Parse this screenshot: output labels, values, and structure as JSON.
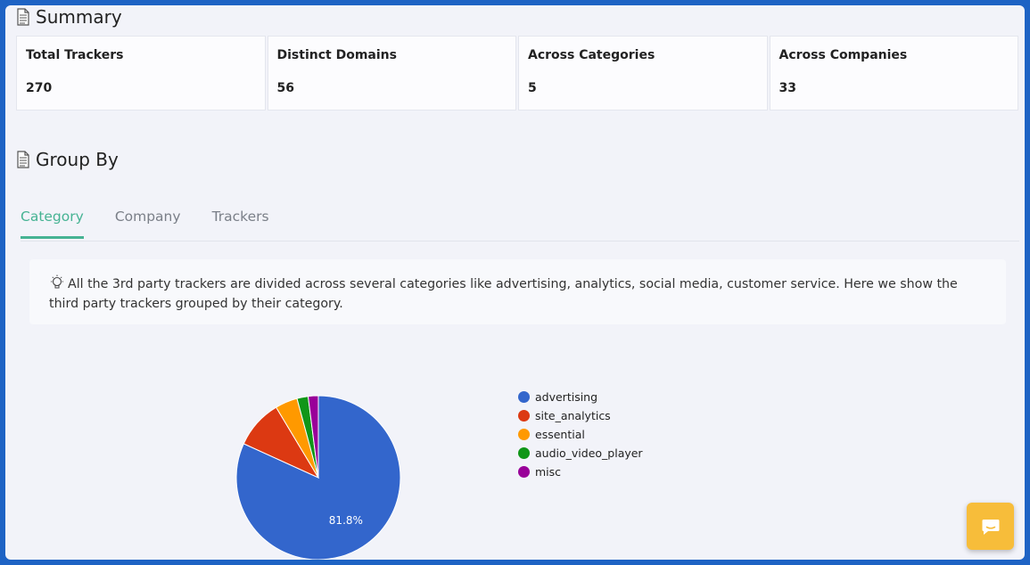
{
  "summary": {
    "title": "Summary",
    "cards": [
      {
        "label": "Total Trackers",
        "value": "270"
      },
      {
        "label": "Distinct Domains",
        "value": "56"
      },
      {
        "label": "Across Categories",
        "value": "5"
      },
      {
        "label": "Across Companies",
        "value": "33"
      }
    ]
  },
  "group_by": {
    "title": "Group By",
    "tabs": [
      {
        "label": "Category",
        "active": true
      },
      {
        "label": "Company",
        "active": false
      },
      {
        "label": "Trackers",
        "active": false
      }
    ],
    "info_text": "All the 3rd party trackers are divided across several categories like advertising, analytics, social media, customer service. Here we show the third party trackers grouped by their category."
  },
  "chart_data": {
    "type": "pie",
    "categories": [
      "advertising",
      "site_analytics",
      "essential",
      "audio_video_player",
      "misc"
    ],
    "values": [
      81.8,
      9.6,
      4.4,
      2.2,
      2.0
    ],
    "colors": [
      "#3366cc",
      "#dc3912",
      "#ff9900",
      "#109618",
      "#990099"
    ],
    "slice_labels": [
      "81.8%",
      "",
      "",
      "",
      ""
    ],
    "legend_position": "right"
  },
  "icons": {
    "section": "document-icon",
    "info": "lightbulb-icon",
    "chat": "chat-bubble-icon"
  }
}
